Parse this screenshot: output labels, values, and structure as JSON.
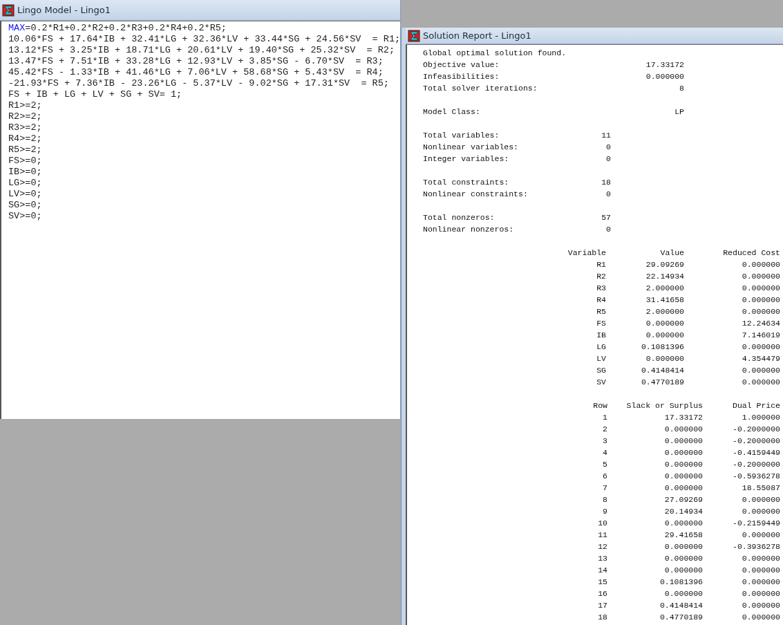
{
  "model_window": {
    "title": "Lingo Model - Lingo1",
    "lines": [
      {
        "keyword": "MAX",
        "text": "=0.2*R1+0.2*R2+0.2*R3+0.2*R4+0.2*R5;"
      },
      {
        "text": "10.06*FS + 17.64*IB + 32.41*LG + 32.36*LV + 33.44*SG + 24.56*SV  = R1;"
      },
      {
        "text": "13.12*FS + 3.25*IB + 18.71*LG + 20.61*LV + 19.40*SG + 25.32*SV  = R2;"
      },
      {
        "text": "13.47*FS + 7.51*IB + 33.28*LG + 12.93*LV + 3.85*SG - 6.70*SV  = R3;"
      },
      {
        "text": "45.42*FS - 1.33*IB + 41.46*LG + 7.06*LV + 58.68*SG + 5.43*SV  = R4;"
      },
      {
        "text": "-21.93*FS + 7.36*IB - 23.26*LG - 5.37*LV - 9.02*SG + 17.31*SV  = R5;"
      },
      {
        "text": "FS + IB + LG + LV + SG + SV= 1;"
      },
      {
        "text": "R1>=2;"
      },
      {
        "text": "R2>=2;"
      },
      {
        "text": "R3>=2;"
      },
      {
        "text": "R4>=2;"
      },
      {
        "text": "R5>=2;"
      },
      {
        "text": "FS>=0;"
      },
      {
        "text": "IB>=0;"
      },
      {
        "text": "LG>=0;"
      },
      {
        "text": "LV>=0;"
      },
      {
        "text": "SG>=0;"
      },
      {
        "text": "SV>=0;"
      }
    ]
  },
  "report_window": {
    "title": "Solution Report - Lingo1",
    "status": "Global optimal solution found.",
    "groups": [
      {
        "kind": "wide",
        "items": [
          {
            "label": "Objective value:",
            "value": "17.33172"
          },
          {
            "label": "Infeasibilities:",
            "value": "0.000000"
          },
          {
            "label": "Total solver iterations:",
            "value": "8"
          }
        ]
      },
      {
        "kind": "wide",
        "items": [
          {
            "label": "Model Class:",
            "value": "LP"
          }
        ]
      },
      {
        "kind": "narrow",
        "items": [
          {
            "label": "Total variables:",
            "value": "11"
          },
          {
            "label": "Nonlinear variables:",
            "value": "0"
          },
          {
            "label": "Integer variables:",
            "value": "0"
          }
        ]
      },
      {
        "kind": "narrow",
        "items": [
          {
            "label": "Total constraints:",
            "value": "18"
          },
          {
            "label": "Nonlinear constraints:",
            "value": "0"
          }
        ]
      },
      {
        "kind": "narrow",
        "items": [
          {
            "label": "Total nonzeros:",
            "value": "57"
          },
          {
            "label": "Nonlinear nonzeros:",
            "value": "0"
          }
        ]
      }
    ],
    "tables": [
      {
        "kind": "variables",
        "columns": [
          "Variable",
          "Value",
          "Reduced Cost"
        ],
        "rows": [
          [
            "R1",
            "29.09269",
            "0.000000"
          ],
          [
            "R2",
            "22.14934",
            "0.000000"
          ],
          [
            "R3",
            "2.000000",
            "0.000000"
          ],
          [
            "R4",
            "31.41658",
            "0.000000"
          ],
          [
            "R5",
            "2.000000",
            "0.000000"
          ],
          [
            "FS",
            "0.000000",
            "12.24634"
          ],
          [
            "IB",
            "0.000000",
            "7.146019"
          ],
          [
            "LG",
            "0.1081396",
            "0.000000"
          ],
          [
            "LV",
            "0.000000",
            "4.354479"
          ],
          [
            "SG",
            "0.4148414",
            "0.000000"
          ],
          [
            "SV",
            "0.4770189",
            "0.000000"
          ]
        ]
      },
      {
        "kind": "rows",
        "columns": [
          "Row",
          "Slack or Surplus",
          "Dual Price"
        ],
        "rows": [
          [
            "1",
            "17.33172",
            "1.000000"
          ],
          [
            "2",
            "0.000000",
            "-0.2000000"
          ],
          [
            "3",
            "0.000000",
            "-0.2000000"
          ],
          [
            "4",
            "0.000000",
            "-0.4159449"
          ],
          [
            "5",
            "0.000000",
            "-0.2000000"
          ],
          [
            "6",
            "0.000000",
            "-0.5936278"
          ],
          [
            "7",
            "0.000000",
            "18.55087"
          ],
          [
            "8",
            "27.09269",
            "0.000000"
          ],
          [
            "9",
            "20.14934",
            "0.000000"
          ],
          [
            "10",
            "0.000000",
            "-0.2159449"
          ],
          [
            "11",
            "29.41658",
            "0.000000"
          ],
          [
            "12",
            "0.000000",
            "-0.3936278"
          ],
          [
            "13",
            "0.000000",
            "0.000000"
          ],
          [
            "14",
            "0.000000",
            "0.000000"
          ],
          [
            "15",
            "0.1081396",
            "0.000000"
          ],
          [
            "16",
            "0.000000",
            "0.000000"
          ],
          [
            "17",
            "0.4148414",
            "0.000000"
          ],
          [
            "18",
            "0.4770189",
            "0.000000"
          ]
        ]
      }
    ]
  }
}
